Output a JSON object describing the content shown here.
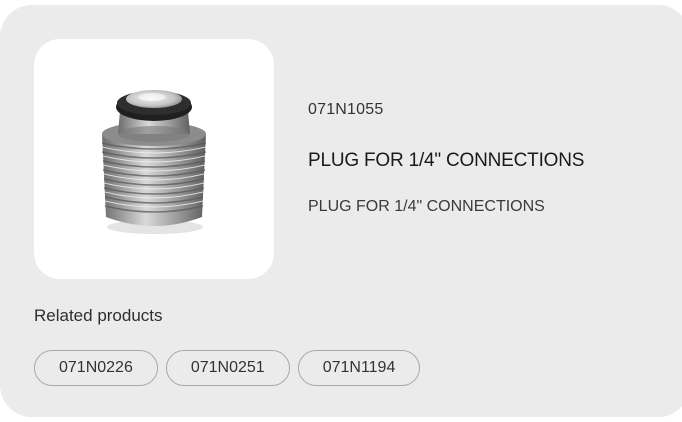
{
  "product": {
    "code": "071N1055",
    "title": "PLUG FOR 1/4\" CONNECTIONS",
    "description": "PLUG FOR 1/4\" CONNECTIONS",
    "image_icon": "threaded-plug-image"
  },
  "related": {
    "label": "Related products",
    "items": [
      {
        "label": "071N0226"
      },
      {
        "label": "071N0251"
      },
      {
        "label": "071N1194"
      }
    ]
  },
  "colors": {
    "card_background": "#ebebeb",
    "image_background": "#ffffff",
    "chip_border": "#a9a9a9"
  }
}
